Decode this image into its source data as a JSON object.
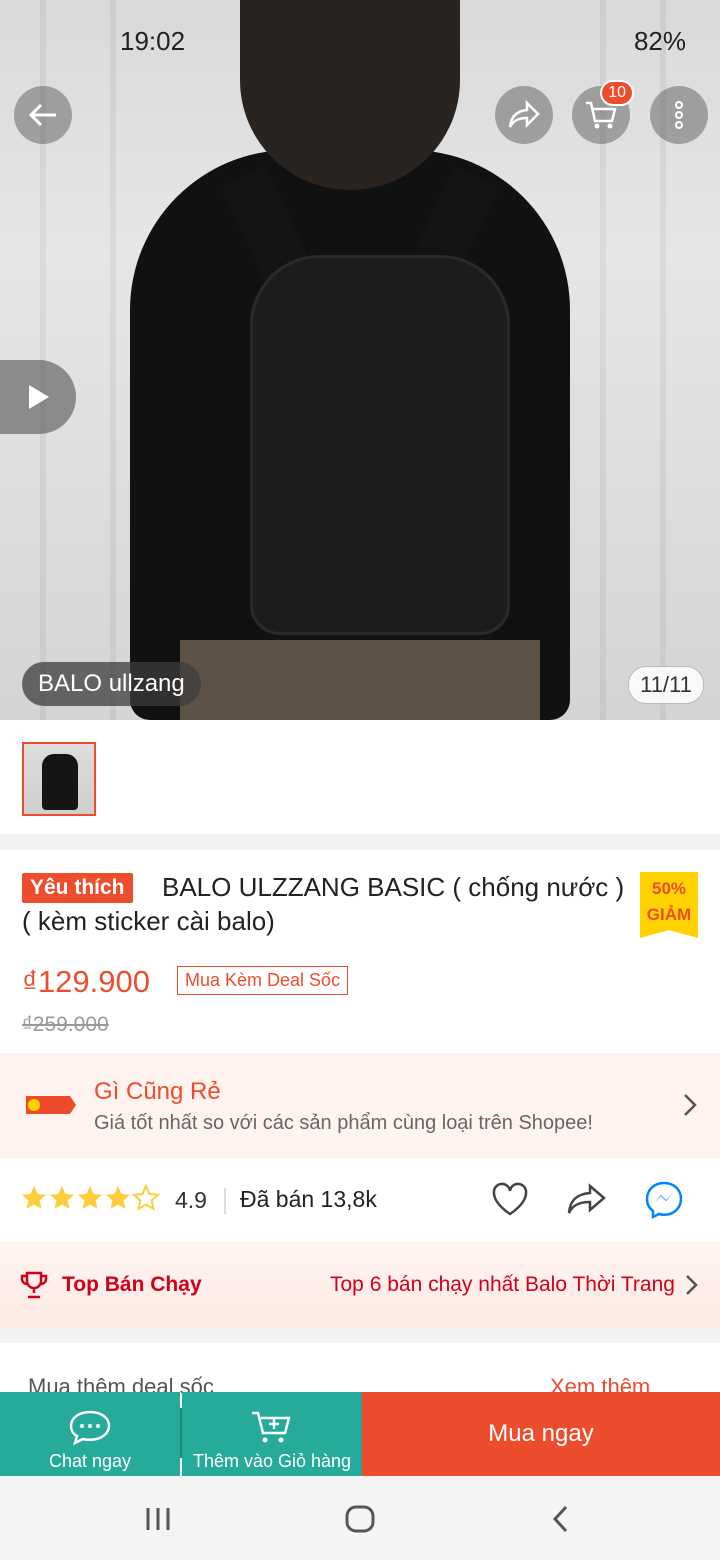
{
  "status": {
    "time": "19:02",
    "battery": "82%"
  },
  "hero": {
    "cart_badge": "10",
    "image_label": "BALO ullzang",
    "counter": "11/11"
  },
  "product": {
    "favorite_tag": "Yêu thích",
    "title": "BALO ULZZANG BASIC ( chống nước ) ( kèm sticker cài balo)",
    "discount_percent": "50%",
    "discount_word": "GIẢM",
    "price": "₫129.900",
    "deal_tag": "Mua Kèm Deal Sốc",
    "old_price": "₫259.000"
  },
  "cheap": {
    "title": "Gì Cũng Rẻ",
    "description": "Giá tốt nhất so với các sản phẩm cùng loại trên Shopee!"
  },
  "rating": {
    "value": "4.9",
    "stars": 4.5,
    "sold": "Đã bán 13,8k"
  },
  "top_sell": {
    "label": "Top Bán Chạy",
    "description": "Top 6 bán chạy nhất Balo Thời Trang"
  },
  "more": {
    "left": "Mua thêm deal sốc",
    "right": "Xem thêm"
  },
  "actions": {
    "chat": "Chat ngay",
    "add_cart": "Thêm vào Giỏ hàng",
    "buy": "Mua ngay"
  },
  "colors": {
    "accent": "#ee4d2d",
    "teal": "#26aa99",
    "star": "#ffce3d"
  }
}
